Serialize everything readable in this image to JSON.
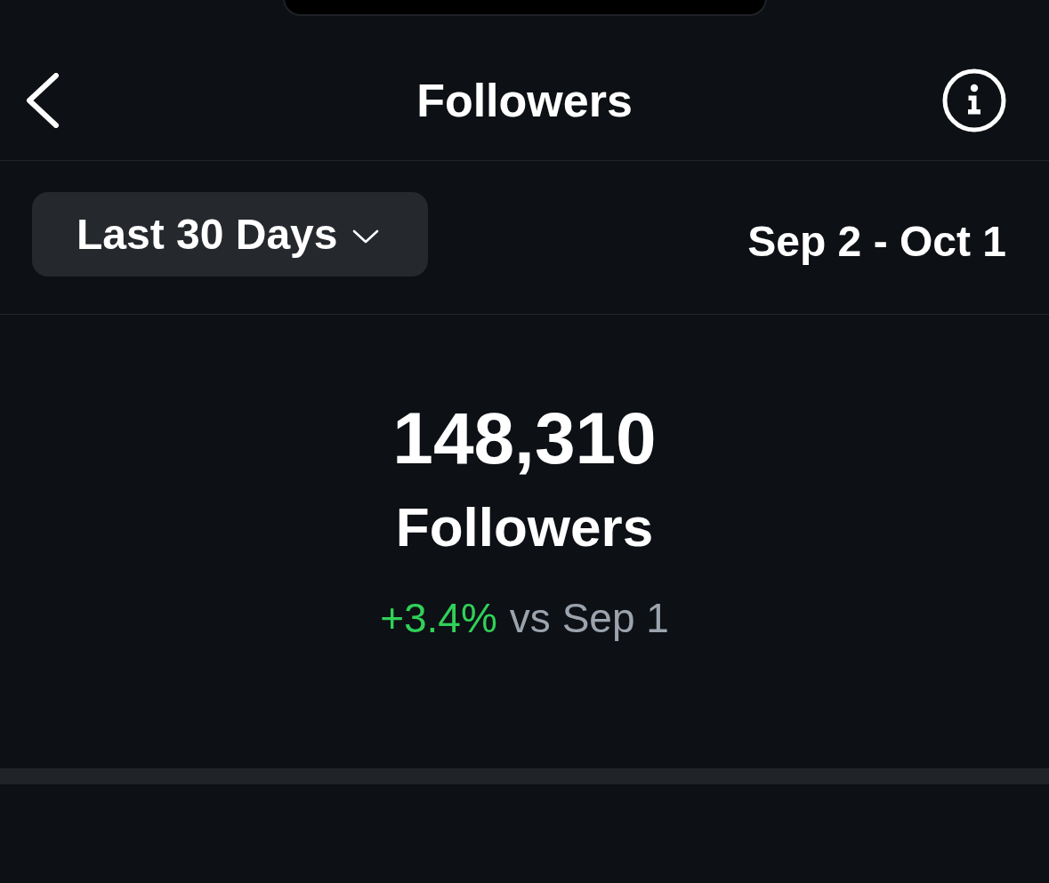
{
  "header": {
    "title": "Followers"
  },
  "filter": {
    "range": "Last 30 Days",
    "dates": "Sep 2 - Oct 1"
  },
  "summary": {
    "count": "148,310",
    "label": "Followers",
    "change": "+3.4%",
    "increase": true,
    "comparison": "vs Sep 1"
  }
}
